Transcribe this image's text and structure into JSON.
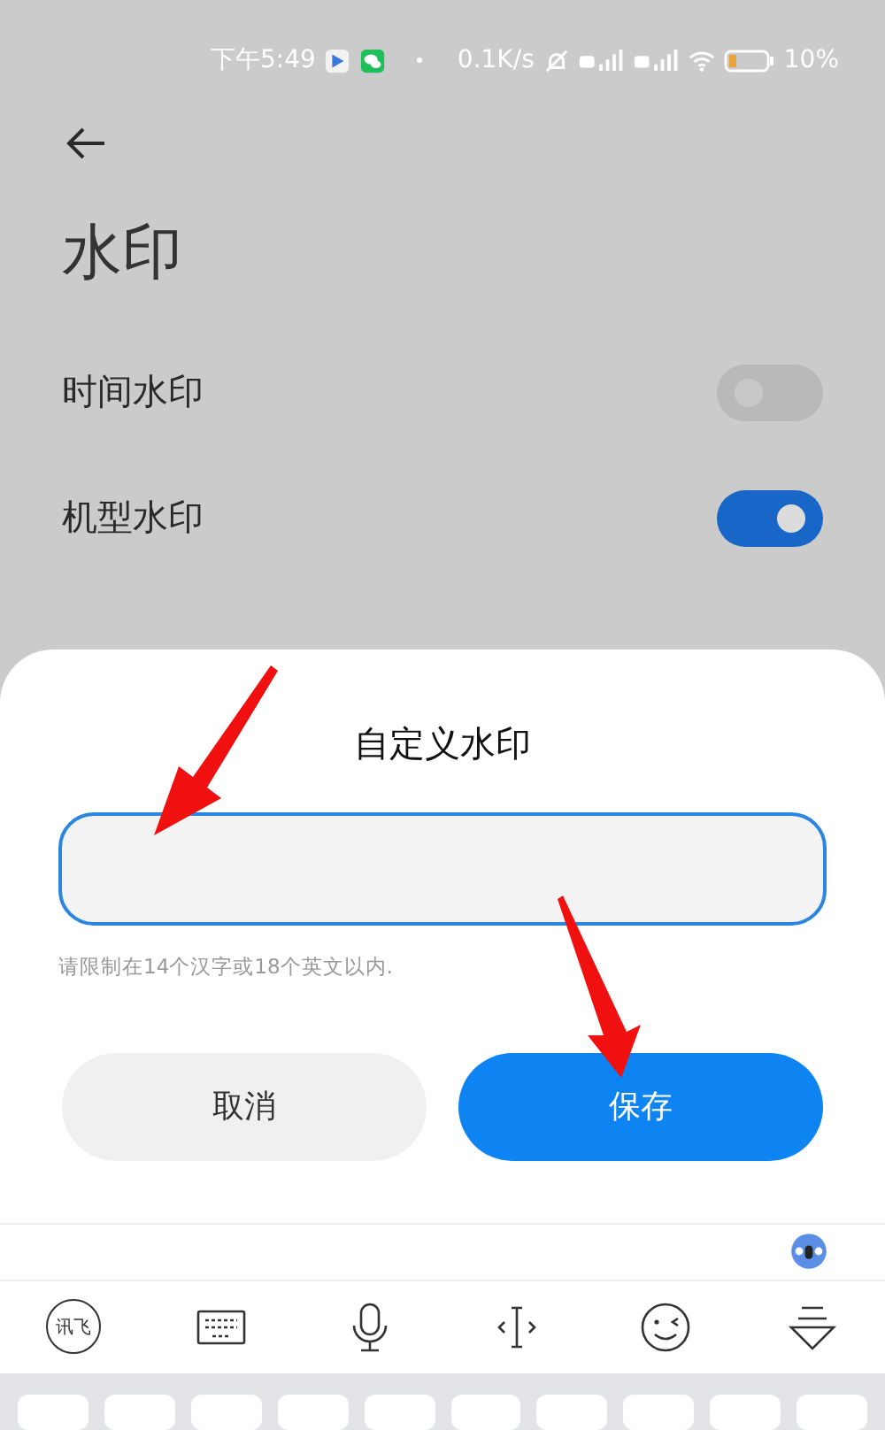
{
  "status_bar": {
    "time": "下午5:49",
    "speed": "0.1K/s",
    "battery": "10%"
  },
  "page": {
    "title": "水印",
    "rows": [
      {
        "kind": "toggle",
        "label": "时间水印",
        "on": false
      },
      {
        "kind": "toggle",
        "label": "机型水印",
        "on": true
      }
    ]
  },
  "dialog": {
    "title": "自定义水印",
    "input": {
      "focused": true
    },
    "hint": "请限制在14个汉字或18个英文以内.",
    "buttons": [
      {
        "label": "取消",
        "kind": "secondary"
      },
      {
        "label": "保存",
        "kind": "primary"
      }
    ]
  },
  "keyboard": {
    "logo": "讯飞"
  }
}
